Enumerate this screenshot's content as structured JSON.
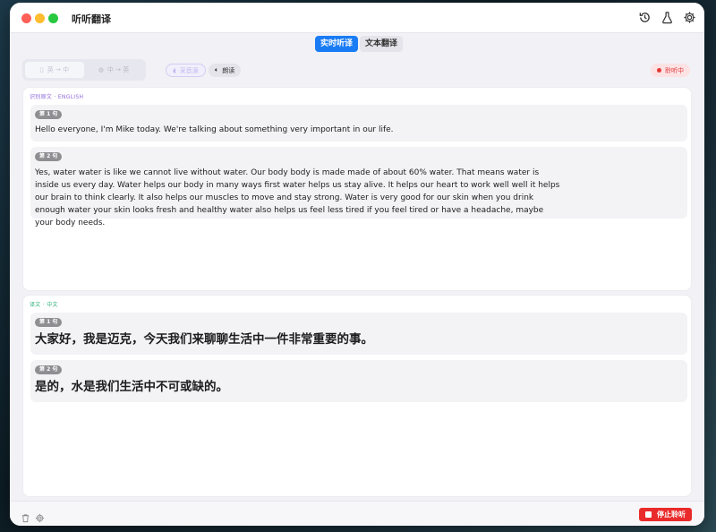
{
  "app": {
    "title": "听听翻译"
  },
  "mode_tabs": [
    {
      "label": "实时听译",
      "active": true
    },
    {
      "label": "文本翻译",
      "active": false
    }
  ],
  "controls": {
    "lang_options": [
      {
        "label": "英 → 中",
        "active": true
      },
      {
        "label": "中 → 英",
        "active": false
      }
    ],
    "capture_label": "采音源",
    "read_label": "朗读",
    "listening_label": "聆听中"
  },
  "source_panel": {
    "label": "识别原文 · ENGLISH",
    "sentences": [
      {
        "badge": "第 1 句",
        "text": "Hello everyone, I'm Mike today. We're talking about something very important in our life."
      },
      {
        "badge": "第 2 句",
        "text": "Yes, water water is like we cannot live without water. Our body body is made made of about 60% water. That means water is inside us every day. Water helps our body in many ways first water helps us stay alive. It helps our heart to work well well it helps our brain to think clearly. It also helps our muscles to move and stay strong. Water is very good for our skin when you drink enough water your skin looks fresh and healthy water also helps us feel less tired if you feel tired or have a headache, maybe your body needs."
      }
    ]
  },
  "translation_panel": {
    "label": "译文 · 中文",
    "sentences": [
      {
        "badge": "第 1 句",
        "text": "大家好，我是迈克，今天我们来聊聊生活中一件非常重要的事。"
      },
      {
        "badge": "第 2 句",
        "text": "是的，水是我们生活中不可或缺的。"
      }
    ]
  },
  "bottom": {
    "stop_label": "停止聆听"
  },
  "icons": {
    "toolbar": [
      "history-icon",
      "flask-icon",
      "gear-icon"
    ],
    "bottom": [
      "trash-icon",
      "settings-icon",
      "stop-icon"
    ]
  },
  "colors": {
    "accent": "#1a7cf5",
    "stop": "#ea2b2b",
    "source_label": "#8e6ad8",
    "translation_label": "#2bb07a"
  }
}
